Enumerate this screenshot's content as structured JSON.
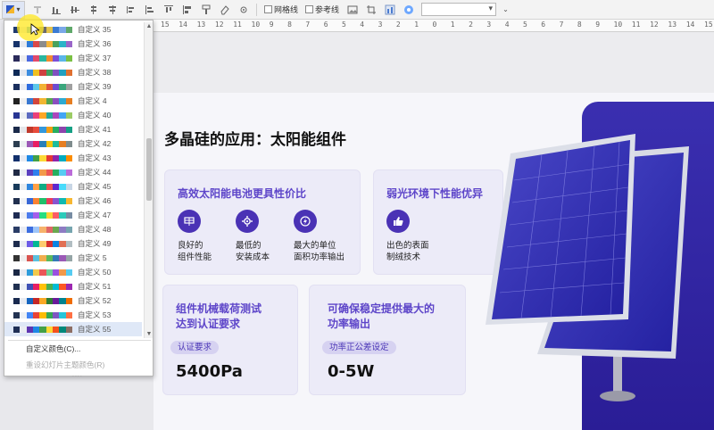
{
  "toolbar": {
    "gridlines_label": "网格线",
    "guides_label": "参考线"
  },
  "ruler": {
    "ticks": [
      "15",
      "14",
      "13",
      "12",
      "11",
      "10",
      "9",
      "8",
      "7",
      "6",
      "5",
      "4",
      "3",
      "2",
      "1",
      "0",
      "1",
      "2",
      "3",
      "4",
      "5",
      "6",
      "7",
      "8",
      "9",
      "10",
      "11",
      "12",
      "13",
      "14",
      "15"
    ]
  },
  "dropdown": {
    "rows": [
      {
        "label": "自定义 35",
        "colors": [
          "#1f3a6e",
          "#dfe4ec",
          "#3aa0d8",
          "#f2a341",
          "#6b6b6b",
          "#e2c24c",
          "#3b7bd3",
          "#7aa8e8",
          "#5fa86a"
        ]
      },
      {
        "label": "自定义 36",
        "colors": [
          "#17346b",
          "#e6e9ef",
          "#2e7bd8",
          "#d94a4a",
          "#8c8c8c",
          "#f3b53a",
          "#4aa25c",
          "#2bb3c7",
          "#9a66c9"
        ]
      },
      {
        "label": "自定义 37",
        "colors": [
          "#2b2b5a",
          "#eeeeee",
          "#4a68e0",
          "#e24a6a",
          "#2ab7a0",
          "#f28a30",
          "#7b4fd6",
          "#5bb6e8",
          "#7ac043"
        ]
      },
      {
        "label": "自定义 38",
        "colors": [
          "#0d2a57",
          "#e4e8ef",
          "#3c8de0",
          "#f0c020",
          "#d04040",
          "#40a060",
          "#8050c0",
          "#20a0c0",
          "#e07030"
        ]
      },
      {
        "label": "自定义 39",
        "colors": [
          "#1a2f5d",
          "#e9ecf2",
          "#2d6cdf",
          "#5cc8e8",
          "#f2b134",
          "#e0523f",
          "#6f4bd1",
          "#3aa67c",
          "#a0a0a0"
        ]
      },
      {
        "label": "自定义 4",
        "colors": [
          "#222222",
          "#f0f0f0",
          "#3978d1",
          "#d3463c",
          "#f1b631",
          "#56a550",
          "#8b4fbf",
          "#2eaad1",
          "#e67e22"
        ]
      },
      {
        "label": "自定义 40",
        "colors": [
          "#283593",
          "#eceff1",
          "#5c6bc0",
          "#ec407a",
          "#ffa726",
          "#26a69a",
          "#ab47bc",
          "#42a5f5",
          "#9ccc65"
        ]
      },
      {
        "label": "自定义 41",
        "colors": [
          "#1b2a4a",
          "#e5e7ea",
          "#c0392b",
          "#e74c3c",
          "#3498db",
          "#f39c12",
          "#27ae60",
          "#8e44ad",
          "#16a085"
        ]
      },
      {
        "label": "自定义 42",
        "colors": [
          "#2c3e50",
          "#ecf0f1",
          "#9b59b6",
          "#e91e63",
          "#2980b9",
          "#f1c40f",
          "#1abc9c",
          "#e67e22",
          "#7f8c8d"
        ]
      },
      {
        "label": "自定义 43",
        "colors": [
          "#12306b",
          "#e8ebf2",
          "#1e88e5",
          "#43a047",
          "#fdd835",
          "#e53935",
          "#8e24aa",
          "#00acc1",
          "#fb8c00"
        ]
      },
      {
        "label": "自定义 44",
        "colors": [
          "#202a44",
          "#eaeef3",
          "#5a3fc0",
          "#2f80ed",
          "#f2994a",
          "#eb5757",
          "#27ae60",
          "#56ccf2",
          "#bb6bd9"
        ]
      },
      {
        "label": "自定义 45",
        "colors": [
          "#183a5a",
          "#e8ecef",
          "#2e86de",
          "#ff9f43",
          "#10ac84",
          "#ee5253",
          "#5f27cd",
          "#48dbfb",
          "#c8d6e5"
        ]
      },
      {
        "label": "自定义 46",
        "colors": [
          "#21304f",
          "#f0f2f5",
          "#3867d6",
          "#fa8231",
          "#20bf6b",
          "#eb3b5a",
          "#8854d0",
          "#0fb9b1",
          "#f7b731"
        ]
      },
      {
        "label": "自定义 47",
        "colors": [
          "#1e2b52",
          "#eceef4",
          "#4b7bec",
          "#a55eea",
          "#26de81",
          "#fed330",
          "#fc5c65",
          "#2bcbba",
          "#778ca3"
        ]
      },
      {
        "label": "自定义 48",
        "colors": [
          "#2a3d66",
          "#e9ecf3",
          "#3c6ee0",
          "#9fc5f8",
          "#f6b26b",
          "#e06666",
          "#6aa84f",
          "#8e7cc3",
          "#76a5af"
        ]
      },
      {
        "label": "自定义 49",
        "colors": [
          "#1d2c4d",
          "#eaedf2",
          "#6c5ce7",
          "#00b894",
          "#fdcb6e",
          "#d63031",
          "#0984e3",
          "#e17055",
          "#b2bec3"
        ]
      },
      {
        "label": "自定义 5",
        "colors": [
          "#333333",
          "#efefef",
          "#d9534f",
          "#5bc0de",
          "#f0ad4e",
          "#5cb85c",
          "#337ab7",
          "#9b59b6",
          "#95a5a6"
        ]
      },
      {
        "label": "自定义 50",
        "colors": [
          "#1a2744",
          "#e7eaf0",
          "#2d9cdb",
          "#f2c94c",
          "#eb5757",
          "#6fcf97",
          "#9b51e0",
          "#f2994a",
          "#56ccf2"
        ]
      },
      {
        "label": "自定义 51",
        "colors": [
          "#203050",
          "#eceff3",
          "#3f51b5",
          "#e91e63",
          "#ffc107",
          "#4caf50",
          "#00bcd4",
          "#ff5722",
          "#9c27b0"
        ]
      },
      {
        "label": "自定义 52",
        "colors": [
          "#192a4f",
          "#e8ebf1",
          "#1565c0",
          "#c62828",
          "#f9a825",
          "#2e7d32",
          "#6a1b9a",
          "#00838f",
          "#ef6c00"
        ]
      },
      {
        "label": "自定义 53",
        "colors": [
          "#243352",
          "#edf0f4",
          "#4285f4",
          "#ea4335",
          "#fbbc05",
          "#34a853",
          "#7e57c2",
          "#26c6da",
          "#ff7043"
        ]
      },
      {
        "label": "自定义 55",
        "colors": [
          "#1f2f55",
          "#e9ecf2",
          "#5e35b1",
          "#1e88e5",
          "#43a047",
          "#fdd835",
          "#f4511e",
          "#00897b",
          "#8d6e63"
        ]
      }
    ],
    "custom_colors_label": "自定义颜色(C)...",
    "reset_colors_label": "重设幻灯片主题颜色(R)"
  },
  "slide": {
    "title": "多晶硅的应用：太阳能组件",
    "card1": {
      "heading": "高效太阳能电池更具性价比",
      "features": [
        {
          "icon": "solar-panel-icon",
          "text1": "良好的",
          "text2": "组件性能"
        },
        {
          "icon": "gear-icon",
          "text1": "最低的",
          "text2": "安装成本"
        },
        {
          "icon": "energy-icon",
          "text1": "最大的单位",
          "text2": "面积功率输出"
        }
      ]
    },
    "card2": {
      "heading": "弱光环境下性能优异",
      "feature": {
        "icon": "thumbs-up-icon",
        "text1": "出色的表面",
        "text2": "制绒技术"
      }
    },
    "card3": {
      "heading1": "组件机械载荷测试",
      "heading2": "达到认证要求",
      "tag": "认证要求",
      "value": "5400Pa"
    },
    "card4": {
      "heading1": "可确保稳定提供最大的",
      "heading2": "功率输出",
      "tag": "功率正公差设定",
      "value": "0-5W"
    }
  },
  "colors": {
    "accent": "#5d45c9",
    "icon_bg": "#4a32b5",
    "panel_blue": "#2b2aa8"
  }
}
